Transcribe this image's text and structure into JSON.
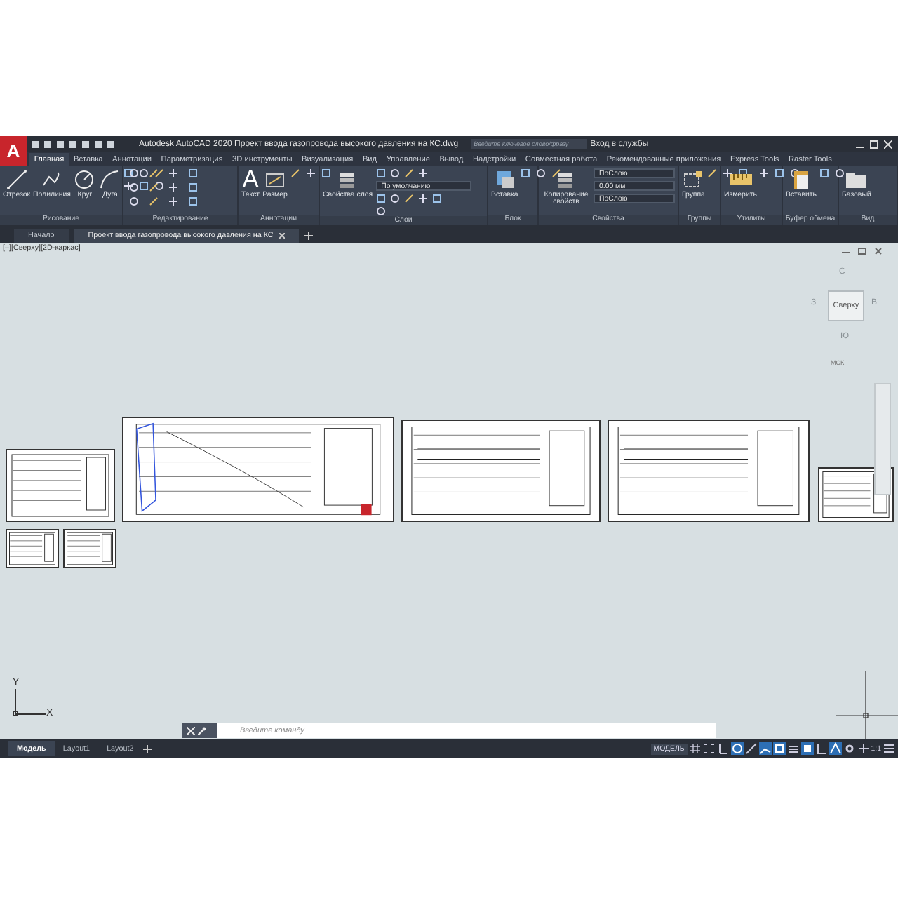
{
  "app_logo": "A",
  "title_bar": {
    "title": "Autodesk AutoCAD 2020  Проект ввода газопровода высокого давления на КС.dwg",
    "search": {
      "placeholder": "Введите ключевое слово/фразу"
    },
    "sign_in": "Вход в службы"
  },
  "ribbon_tabs": [
    {
      "label": "Главная",
      "selected": true
    },
    {
      "label": "Вставка",
      "selected": false
    },
    {
      "label": "Аннотации",
      "selected": false
    },
    {
      "label": "Параметризация",
      "selected": false
    },
    {
      "label": "3D инструменты",
      "selected": false
    },
    {
      "label": "Визуализация",
      "selected": false
    },
    {
      "label": "Вид",
      "selected": false
    },
    {
      "label": "Управление",
      "selected": false
    },
    {
      "label": "Вывод",
      "selected": false
    },
    {
      "label": "Надстройки",
      "selected": false
    },
    {
      "label": "Совместная работа",
      "selected": false
    },
    {
      "label": "Рекомендованные приложения",
      "selected": false
    },
    {
      "label": "Express Tools",
      "selected": false
    },
    {
      "label": "Raster Tools",
      "selected": false
    }
  ],
  "panels": [
    {
      "title": "Рисование",
      "tools": [
        "Отрезок",
        "Полилиния",
        "Круг",
        "Дуга"
      ]
    },
    {
      "title": "Редактирование"
    },
    {
      "title": "Аннотации",
      "tools": [
        "Текст",
        "Размер"
      ],
      "text_icon": "A"
    },
    {
      "title": "Слои",
      "tools": [
        "Свойства слоя"
      ],
      "dropdowns": [
        "По умолчанию"
      ]
    },
    {
      "title": "Блок",
      "tools": [
        "Вставка"
      ]
    },
    {
      "title": "Свойства",
      "tools": [
        "Копирование свойств"
      ],
      "dropdowns": [
        "ПоСлою",
        "0.00 мм",
        "ПоСлою"
      ]
    },
    {
      "title": "Группы",
      "tools": [
        "Группа"
      ]
    },
    {
      "title": "Утилиты",
      "tools": [
        "Измерить"
      ]
    },
    {
      "title": "Буфер обмена",
      "tools": [
        "Вставить"
      ]
    },
    {
      "title": "Вид",
      "tools": [
        "Базовый"
      ]
    }
  ],
  "document_tabs": [
    {
      "label": "Начало",
      "selected": false
    },
    {
      "label": "Проект ввода газопровода высокого давления на КС",
      "selected": true
    }
  ],
  "viewport": {
    "label": "[–][Сверху][2D-каркас]",
    "viewcube": {
      "top": "Сверху",
      "north": "С",
      "west": "З",
      "east": "В",
      "south": "Ю",
      "ucs": "МСК"
    },
    "ucs_x": "X",
    "ucs_y": "Y"
  },
  "command_line": {
    "placeholder": "Введите команду"
  },
  "layout_tabs": [
    {
      "label": "Модель",
      "selected": true
    },
    {
      "label": "Layout1",
      "selected": false
    },
    {
      "label": "Layout2",
      "selected": false
    }
  ],
  "status_bar": {
    "mode": "МОДЕЛЬ",
    "scale": "1:1",
    "toggles": [
      {
        "on": false
      },
      {
        "on": false
      },
      {
        "on": false
      },
      {
        "on": true
      },
      {
        "on": false
      },
      {
        "on": true
      },
      {
        "on": true
      },
      {
        "on": false
      },
      {
        "on": true
      },
      {
        "on": false
      },
      {
        "on": true
      },
      {
        "on": false
      },
      {
        "on": false
      }
    ]
  }
}
